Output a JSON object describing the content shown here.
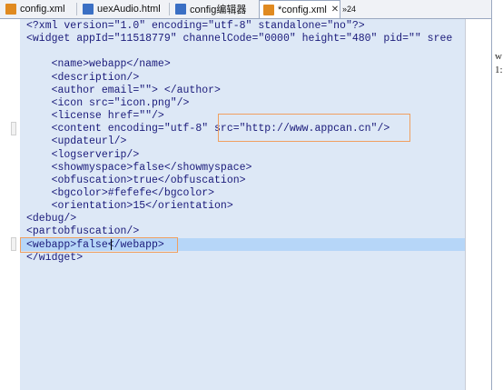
{
  "tabs": [
    {
      "label": "config.xml",
      "icon": "xml-file-icon",
      "color": "#e08a20"
    },
    {
      "label": "uexAudio.html",
      "icon": "html-file-icon",
      "color": "#3a6fc4"
    },
    {
      "label": "config编辑器",
      "icon": "editor-icon",
      "color": "#3a6fc4"
    },
    {
      "label": "*config.xml",
      "icon": "xml-file-icon",
      "color": "#e08a20",
      "close": "✕"
    }
  ],
  "overflow_count": "»24",
  "code_lines": [
    "<?xml version=\"1.0\" encoding=\"utf-8\" standalone=\"no\"?>",
    "<widget appId=\"11518779\" channelCode=\"0000\" height=\"480\" pid=\"\" sree",
    "",
    "    <name>webapp</name>",
    "    <description/>",
    "    <author email=\"\"> </author>",
    "    <icon src=\"icon.png\"/>",
    "    <license href=\"\"/>",
    "    <content encoding=\"utf-8\" src=\"http://www.appcan.cn\"/>",
    "    <updateurl/>",
    "    <logserverip/>",
    "    <showmyspace>false</showmyspace>",
    "    <obfuscation>true</obfuscation>",
    "    <bgcolor>#fefefe</bgcolor>",
    "    <orientation>15</orientation>",
    "<debug/>",
    "<partobfuscation/>",
    "<webapp>false</webapp>",
    "</widget>"
  ],
  "right_pane_text": [
    "w",
    "1:"
  ],
  "colors": {
    "highlight": "#b6d6f8",
    "editor_bg": "#dde8f6",
    "callout": "#f0a060"
  }
}
